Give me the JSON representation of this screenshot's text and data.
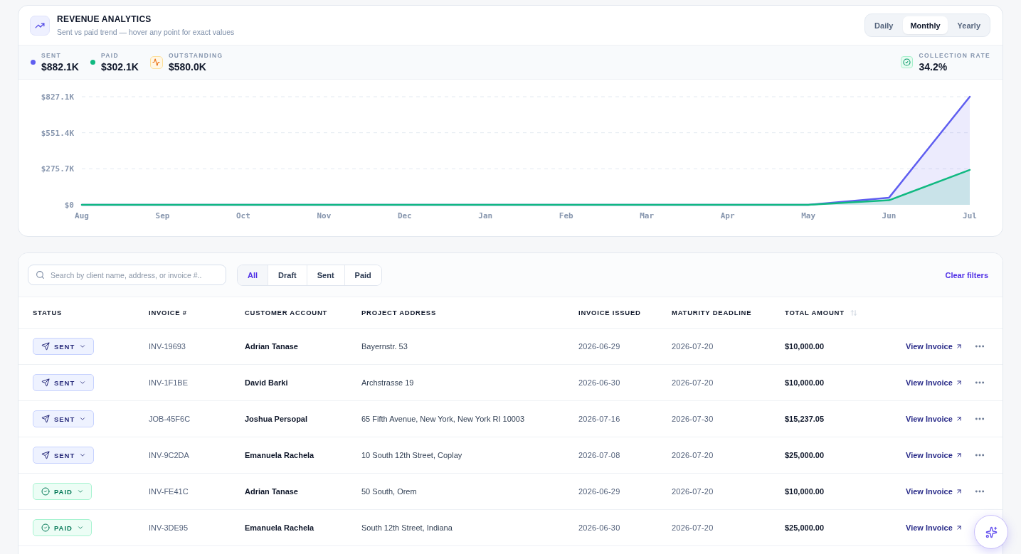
{
  "analytics": {
    "title": "REVENUE ANALYTICS",
    "subtitle": "Sent vs paid trend — hover any point for exact values",
    "periods": [
      {
        "label": "Daily",
        "selected": false
      },
      {
        "label": "Monthly",
        "selected": true
      },
      {
        "label": "Yearly",
        "selected": false
      }
    ],
    "stats": [
      {
        "kind": "series",
        "value": "$882.1K"
      },
      {
        "kind": "series",
        "value": "$302.1K"
      },
      {
        "kind": "pulse",
        "label": "OUTSTANDING",
        "value": "$580.0K"
      }
    ],
    "collection_rate": {
      "label": "COLLECTION RATE",
      "value": "34.2%"
    },
    "chart_data": {
      "type": "area",
      "categories": [
        "Aug",
        "Sep",
        "Oct",
        "Nov",
        "Dec",
        "Jan",
        "Feb",
        "Mar",
        "Apr",
        "May",
        "Jun",
        "Jul"
      ],
      "series": [
        {
          "name": "SENT",
          "color": "#5f5ef0",
          "values": [
            0,
            0,
            0,
            0,
            0,
            0,
            0,
            0,
            0,
            0,
            55,
            827
          ]
        },
        {
          "name": "PAID",
          "color": "#10b981",
          "values": [
            0,
            0,
            0,
            0,
            0,
            0,
            0,
            0,
            0,
            0,
            35,
            267
          ]
        }
      ],
      "ylim": [
        0,
        827.1
      ],
      "yticks": [
        {
          "value": 0,
          "label": "$0"
        },
        {
          "value": 275.7,
          "label": "$275.7K"
        },
        {
          "value": 551.4,
          "label": "$551.4K"
        },
        {
          "value": 827.1,
          "label": "$827.1K"
        }
      ]
    }
  },
  "invoices": {
    "search": {
      "placeholder": "Search by client name, address, or invoice #.."
    },
    "filters": [
      {
        "label": "All",
        "selected": true
      },
      {
        "label": "Draft",
        "selected": false
      },
      {
        "label": "Sent",
        "selected": false
      },
      {
        "label": "Paid",
        "selected": false
      }
    ],
    "clear_filters": "Clear filters",
    "columns": [
      {
        "label": "STATUS",
        "sortable": false
      },
      {
        "label": "INVOICE #",
        "sortable": false
      },
      {
        "label": "CUSTOMER ACCOUNT",
        "sortable": false
      },
      {
        "label": "PROJECT ADDRESS",
        "sortable": false
      },
      {
        "label": "INVOICE ISSUED",
        "sortable": false
      },
      {
        "label": "MATURITY DEADLINE",
        "sortable": false
      },
      {
        "label": "TOTAL AMOUNT",
        "sortable": true
      }
    ],
    "rows": [
      {
        "status": {
          "kind": "sent",
          "label": "SENT"
        },
        "invoice": "INV-19693",
        "customer": "Adrian Tanase",
        "address": "Bayernstr. 53",
        "issued": "2026-06-29",
        "deadline": "2026-07-20",
        "total": "$10,000.00",
        "action": "View Invoice",
        "menu": true
      },
      {
        "status": {
          "kind": "sent",
          "label": "SENT"
        },
        "invoice": "INV-1F1BE",
        "customer": "David Barki",
        "address": "Archstrasse 19",
        "issued": "2026-06-30",
        "deadline": "2026-07-20",
        "total": "$10,000.00",
        "action": "View Invoice",
        "menu": true
      },
      {
        "status": {
          "kind": "sent",
          "label": "SENT"
        },
        "invoice": "JOB-45F6C",
        "customer": "Joshua Persopal",
        "address": "65 Fifth Avenue, New York, New York RI 10003",
        "issued": "2026-07-16",
        "deadline": "2026-07-30",
        "total": "$15,237.05",
        "action": "View Invoice",
        "menu": true
      },
      {
        "status": {
          "kind": "sent",
          "label": "SENT"
        },
        "invoice": "INV-9C2DA",
        "customer": "Emanuela Rachela",
        "address": "10 South 12th Street, Coplay",
        "issued": "2026-07-08",
        "deadline": "2026-07-20",
        "total": "$25,000.00",
        "action": "View Invoice",
        "menu": true
      },
      {
        "status": {
          "kind": "paid",
          "label": "PAID"
        },
        "invoice": "INV-FE41C",
        "customer": "Adrian Tanase",
        "address": "50 South, Orem",
        "issued": "2026-06-29",
        "deadline": "2026-07-20",
        "total": "$10,000.00",
        "action": "View Invoice",
        "menu": true
      },
      {
        "status": {
          "kind": "paid",
          "label": "PAID"
        },
        "invoice": "INV-3DE95",
        "customer": "Emanuela Rachela",
        "address": "South 12th Street, Indiana",
        "issued": "2026-06-30",
        "deadline": "2026-07-20",
        "total": "$25,000.00",
        "action": "View Invoice",
        "menu": false
      }
    ]
  }
}
